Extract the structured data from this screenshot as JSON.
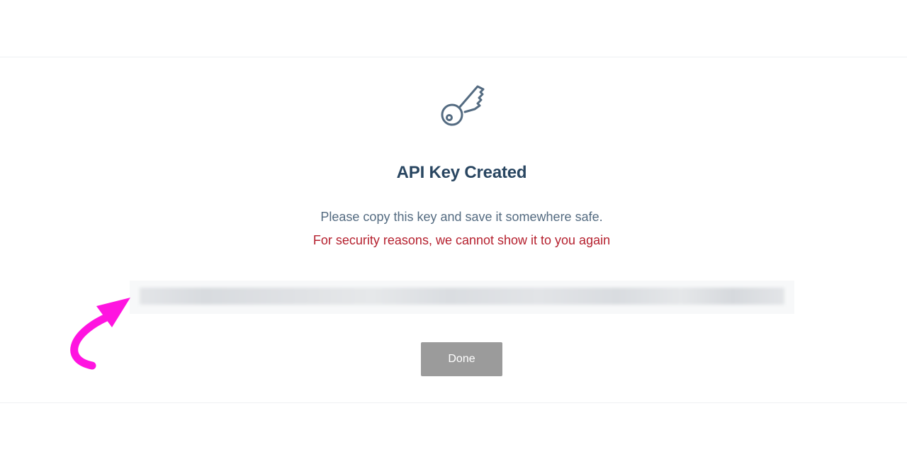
{
  "dialog": {
    "icon": "key-icon",
    "title": "API Key Created",
    "subtitle": "Please copy this key and save it somewhere safe.",
    "warning": "For security reasons, we cannot show it to you again",
    "done_label": "Done"
  },
  "annotation": {
    "icon": "curved-arrow-icon",
    "color": "#ff14e0"
  },
  "colors": {
    "title": "#294661",
    "subtitle": "#546b81",
    "warning": "#b5202e",
    "button_bg": "#9b9b9b"
  }
}
